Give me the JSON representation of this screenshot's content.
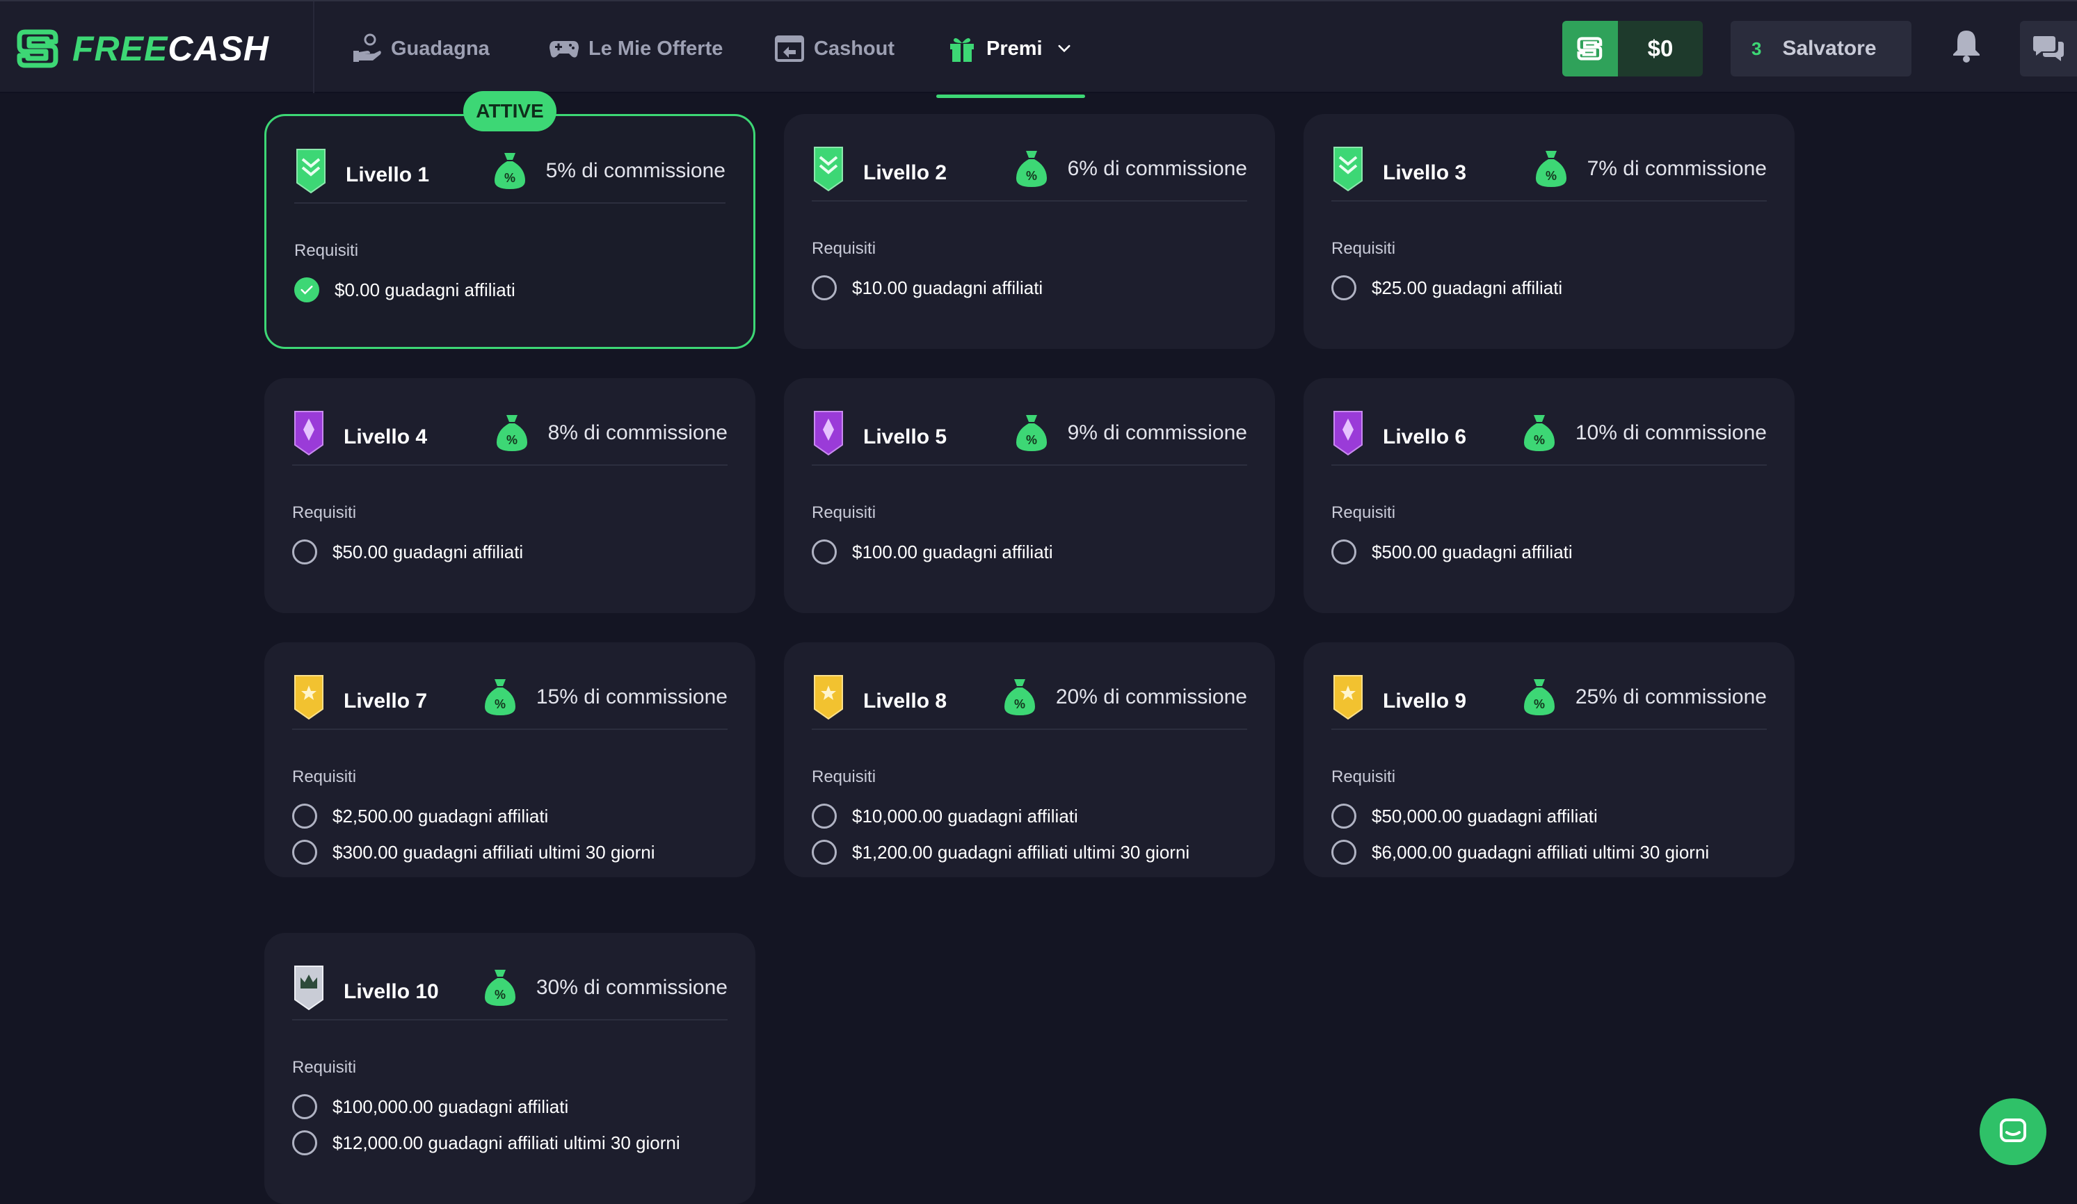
{
  "brand": {
    "part1": "FREE",
    "part2": "CASH"
  },
  "nav": [
    {
      "label": "Guadagna",
      "icon": "hand-coin-icon"
    },
    {
      "label": "Le Mie Offerte",
      "icon": "gamepad-icon"
    },
    {
      "label": "Cashout",
      "icon": "cashout-icon"
    },
    {
      "label": "Premi",
      "icon": "gift-icon",
      "active": true
    }
  ],
  "balance": {
    "amount": "$0"
  },
  "user": {
    "level": "3",
    "name": "Salvatore"
  },
  "active_badge": "ATTIVE",
  "requirements_label": "Requisiti",
  "colors": {
    "accent": "#3dd775",
    "background": "#141523",
    "card": "#1d1e2d"
  },
  "levels": [
    {
      "name": "Livello 1",
      "commission": "5% di commissione",
      "badge": "green-chevron-badge-icon",
      "requirements": [
        "$0.00 guadagni affiliati"
      ],
      "completed": true
    },
    {
      "name": "Livello 2",
      "commission": "6% di commissione",
      "badge": "green-chevron-badge-icon",
      "requirements": [
        "$10.00 guadagni affiliati"
      ]
    },
    {
      "name": "Livello 3",
      "commission": "7% di commissione",
      "badge": "green-chevron-badge-icon",
      "requirements": [
        "$25.00 guadagni affiliati"
      ]
    },
    {
      "name": "Livello 4",
      "commission": "8% di commissione",
      "badge": "purple-gem-badge-icon",
      "requirements": [
        "$50.00 guadagni affiliati"
      ]
    },
    {
      "name": "Livello 5",
      "commission": "9% di commissione",
      "badge": "purple-gem-badge-icon",
      "requirements": [
        "$100.00 guadagni affiliati"
      ]
    },
    {
      "name": "Livello 6",
      "commission": "10% di commissione",
      "badge": "purple-gem-badge-icon",
      "requirements": [
        "$500.00 guadagni affiliati"
      ]
    },
    {
      "name": "Livello 7",
      "commission": "15% di commissione",
      "badge": "gold-star-badge-icon",
      "requirements": [
        "$2,500.00 guadagni affiliati",
        "$300.00 guadagni affiliati ultimi 30 giorni"
      ]
    },
    {
      "name": "Livello 8",
      "commission": "20% di commissione",
      "badge": "gold-star-badge-icon",
      "requirements": [
        "$10,000.00 guadagni affiliati",
        "$1,200.00 guadagni affiliati ultimi 30 giorni"
      ]
    },
    {
      "name": "Livello 9",
      "commission": "25% di commissione",
      "badge": "gold-star-badge-icon",
      "requirements": [
        "$50,000.00 guadagni affiliati",
        "$6,000.00 guadagni affiliati ultimi 30 giorni"
      ]
    },
    {
      "name": "Livello 10",
      "commission": "30% di commissione",
      "badge": "silver-crown-badge-icon",
      "requirements": [
        "$100,000.00 guadagni affiliati",
        "$12,000.00 guadagni affiliati ultimi 30 giorni"
      ]
    }
  ]
}
